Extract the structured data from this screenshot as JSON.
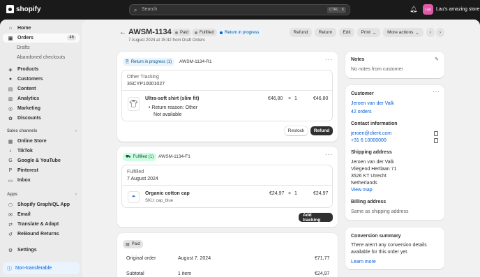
{
  "topbar": {
    "brand": "shopify",
    "search_placeholder": "Search",
    "kbd1": "CTRL",
    "kbd2": "K",
    "store_initials": "Lau",
    "store_name": "Lau's amazing store"
  },
  "sidebar": {
    "items": [
      {
        "label": "Home",
        "icon": "home-icon"
      },
      {
        "label": "Orders",
        "icon": "orders-icon",
        "count": "46"
      },
      {
        "label": "Drafts"
      },
      {
        "label": "Abandoned checkouts"
      },
      {
        "label": "Products",
        "icon": "tag-icon"
      },
      {
        "label": "Customers",
        "icon": "person-icon"
      },
      {
        "label": "Content",
        "icon": "content-icon"
      },
      {
        "label": "Analytics",
        "icon": "analytics-icon"
      },
      {
        "label": "Marketing",
        "icon": "marketing-icon"
      },
      {
        "label": "Discounts",
        "icon": "discount-icon"
      }
    ],
    "sales_title": "Sales channels",
    "sales": [
      "Online Store",
      "TikTok",
      "Google & YouTube",
      "Pinterest",
      "Inbox"
    ],
    "apps_title": "Apps",
    "apps": [
      "Shopify GraphiQL App",
      "Email",
      "Translate & Adapt",
      "ReBound Returns"
    ],
    "settings": "Settings",
    "nontransferable": "Non-transferable"
  },
  "header": {
    "title": "AWSM-1134",
    "badge_paid": "Paid",
    "badge_fulfilled": "Fulfilled",
    "badge_return": "Return in progress",
    "subline": "7 August 2024 at 15:42 from Draft Orders",
    "btn_refund": "Refund",
    "btn_return": "Return",
    "btn_edit": "Edit",
    "btn_print": "Print",
    "btn_more": "More actions"
  },
  "return_card": {
    "badge": "Return in progress (1)",
    "id": "AWSM-1134-R1",
    "tracking_label": "Other Tracking",
    "tracking_number": "3SCYP10001027",
    "item_name": "Ultra-soft shirt (slim fit)",
    "price": "€46,80",
    "times": "×",
    "qty": "1",
    "total": "€46,80",
    "reason": "Return reason: Other",
    "reason_detail": "Not available",
    "btn_restock": "Restock",
    "btn_refund": "Refund"
  },
  "fulfilled_card": {
    "badge": "Fulfilled (1)",
    "id": "AWSM-1134-F1",
    "label": "Fulfilled",
    "date": "7 August 2024",
    "item_name": "Organic cotton cap",
    "sku": "SKU: cap_blue",
    "price": "€24,97",
    "times": "×",
    "qty": "1",
    "total": "€24,97",
    "btn_tracking": "Add tracking"
  },
  "paid_card": {
    "badge": "Paid",
    "rows": [
      {
        "label": "Original order",
        "mid": "August 7, 2024",
        "value": "€71,77"
      },
      {
        "label": "Subtotal",
        "mid": "1 item",
        "value": "€24,97"
      }
    ]
  },
  "notes": {
    "title": "Notes",
    "text": "No notes from customer"
  },
  "customer": {
    "title": "Customer",
    "name": "Jeroen van der Valk",
    "orders": "42 orders",
    "contact_title": "Contact information",
    "email": "jeroen@client.com",
    "phone": "+31 6 10000000",
    "shipping_title": "Shipping address",
    "address": [
      "Jeroen van der Valk",
      "Vliegend Hertlaan 71",
      "3526 KT Utrecht",
      "Netherlands"
    ],
    "view_map": "View map",
    "billing_title": "Billing address",
    "billing_text": "Same as shipping address"
  },
  "conversion": {
    "title": "Conversion summary",
    "text1": "There aren't any conversion details",
    "text2": "available for this order yet.",
    "link": "Learn more"
  },
  "colors": {
    "accent": "#005bd3",
    "topbar": "#1a1a1a",
    "store_avatar": "#e05aa8"
  }
}
